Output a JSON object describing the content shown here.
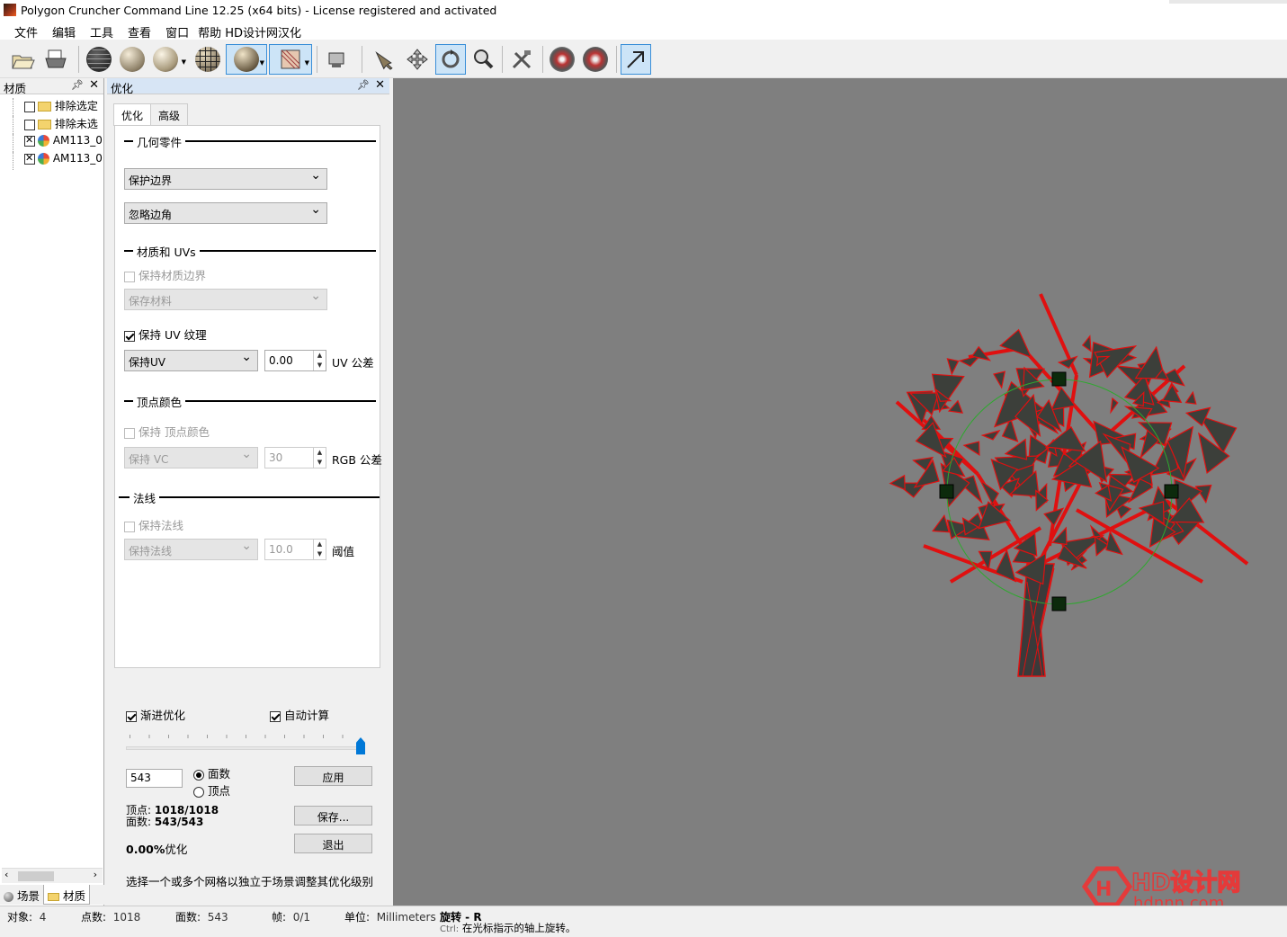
{
  "window": {
    "title": "Polygon Cruncher Command Line 12.25 (x64 bits) - License registered and activated"
  },
  "menu": [
    "文件",
    "编辑",
    "工具",
    "查看",
    "窗口",
    "帮助 HD设计网汉化"
  ],
  "toolbar": {
    "icons": [
      "open-icon",
      "print-icon",
      "wireframe-sphere-icon",
      "smooth-sphere-icon",
      "flat-sphere-icon",
      "grid-sphere-icon",
      "shaded-sphere-icon",
      "texture-icon",
      "camera-icon",
      "select-arrow-icon",
      "move-icon",
      "rotate-icon",
      "zoom-icon",
      "tools-icon",
      "radiation-icon",
      "star-icon",
      "diagonal-arrow-icon"
    ]
  },
  "left_panel": {
    "title": "材质",
    "tree": [
      {
        "label": "排除选定",
        "checked": false,
        "icon": "folder-icon"
      },
      {
        "label": "排除未选",
        "checked": false,
        "icon": "folder-icon"
      },
      {
        "label": "AM113_0",
        "checked": true,
        "icon": "material-icon"
      },
      {
        "label": "AM113_0",
        "checked": true,
        "icon": "material-icon"
      }
    ],
    "bottom_tabs": [
      "场景",
      "材质"
    ]
  },
  "optimize_panel": {
    "title": "优化",
    "tabs": [
      "优化",
      "高级"
    ],
    "geometry": {
      "group": "几何零件",
      "dropdown1": "保护边界",
      "dropdown2": "忽略边角"
    },
    "materials": {
      "group": "材质和 UVs",
      "keep_mat_borders": "保持材质边界",
      "keep_mat_select": "保存材料",
      "keep_uv": "保持 UV 纹理",
      "uv_select": "保持UV",
      "uv_value": "0.00",
      "uv_label": "UV 公差"
    },
    "vertex_color": {
      "group": "顶点颜色",
      "keep_vc": "保持 顶点颜色",
      "vc_select": "保持 VC",
      "vc_value": "30",
      "vc_label": "RGB 公差"
    },
    "normals": {
      "group": "法线",
      "keep_normals": "保持法线",
      "normal_select": "保持法线",
      "normal_value": "10.0",
      "normal_label": "阈值"
    },
    "progressive": "渐进优化",
    "autocalc": "自动计算",
    "slider_fraction": 1.0,
    "count_value": "543",
    "radio_faces": "面数",
    "radio_vertices": "顶点",
    "apply": "应用",
    "save": "保存...",
    "exit": "退出",
    "stats_vertices_label": "顶点:",
    "stats_vertices": "1018/1018",
    "stats_faces_label": "面数:",
    "stats_faces": "543/543",
    "stats_pct": "0.00%",
    "stats_pct_label": "优化",
    "hint": "选择一个或多个网格以独立于场景调整其优化级别"
  },
  "statusbar": {
    "objects_label": "对象:",
    "objects": "4",
    "points_label": "点数:",
    "points": "1018",
    "faces_label": "面数:",
    "faces": "543",
    "frames_label": "帧:",
    "frames": "0/1",
    "units_label": "单位:",
    "units": "Millimeters",
    "mode": "旋转 - R",
    "ctrl": "Ctrl:",
    "mode_hint": "在光标指示的轴上旋转。"
  },
  "watermark": {
    "brand": "HD设计网",
    "url": "hdnnn.com",
    "letter": "H"
  },
  "colors": {
    "accent": "#0078d7",
    "viewport": "#7f7f7f",
    "wire": "#e01010",
    "gizmo": "#2fa82f"
  }
}
